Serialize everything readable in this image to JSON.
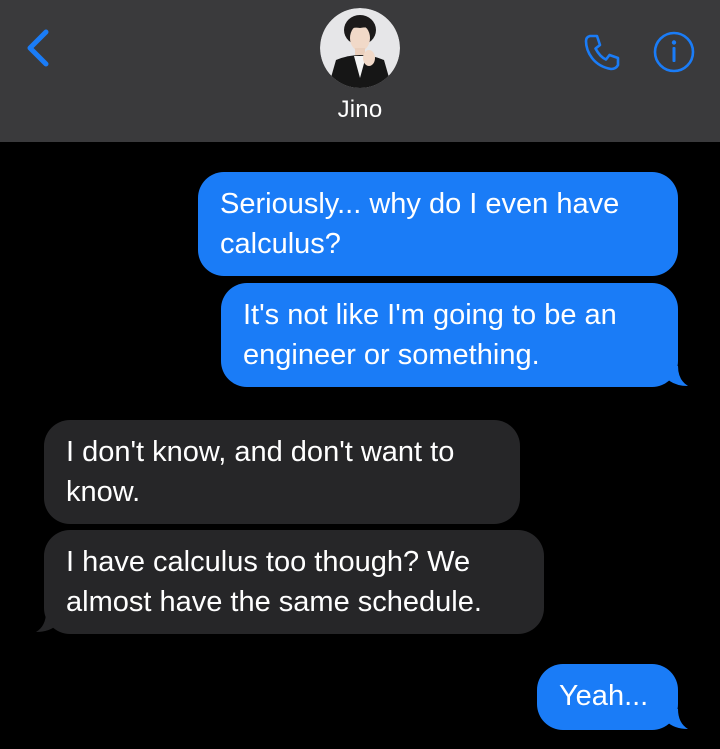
{
  "header": {
    "contact_name": "Jino",
    "back_icon": "chevron-left-icon",
    "call_icon": "phone-icon",
    "info_icon": "info-icon",
    "accent_color": "#1a7cf7",
    "bar_color": "#3a3a3c"
  },
  "messages": [
    {
      "direction": "sent",
      "text": "Seriously... why do I even have\ncalculus?"
    },
    {
      "direction": "sent",
      "text": "It's not like I'm going to be an\nengineer or something."
    },
    {
      "direction": "received",
      "text": "I don't know, and don't want to\nknow."
    },
    {
      "direction": "received",
      "text": "I have calculus too though? We\nalmost have the same schedule."
    },
    {
      "direction": "sent",
      "text": "Yeah..."
    }
  ],
  "colors": {
    "sent_bubble": "#1a7cf7",
    "received_bubble": "#262628",
    "background": "#000000"
  }
}
